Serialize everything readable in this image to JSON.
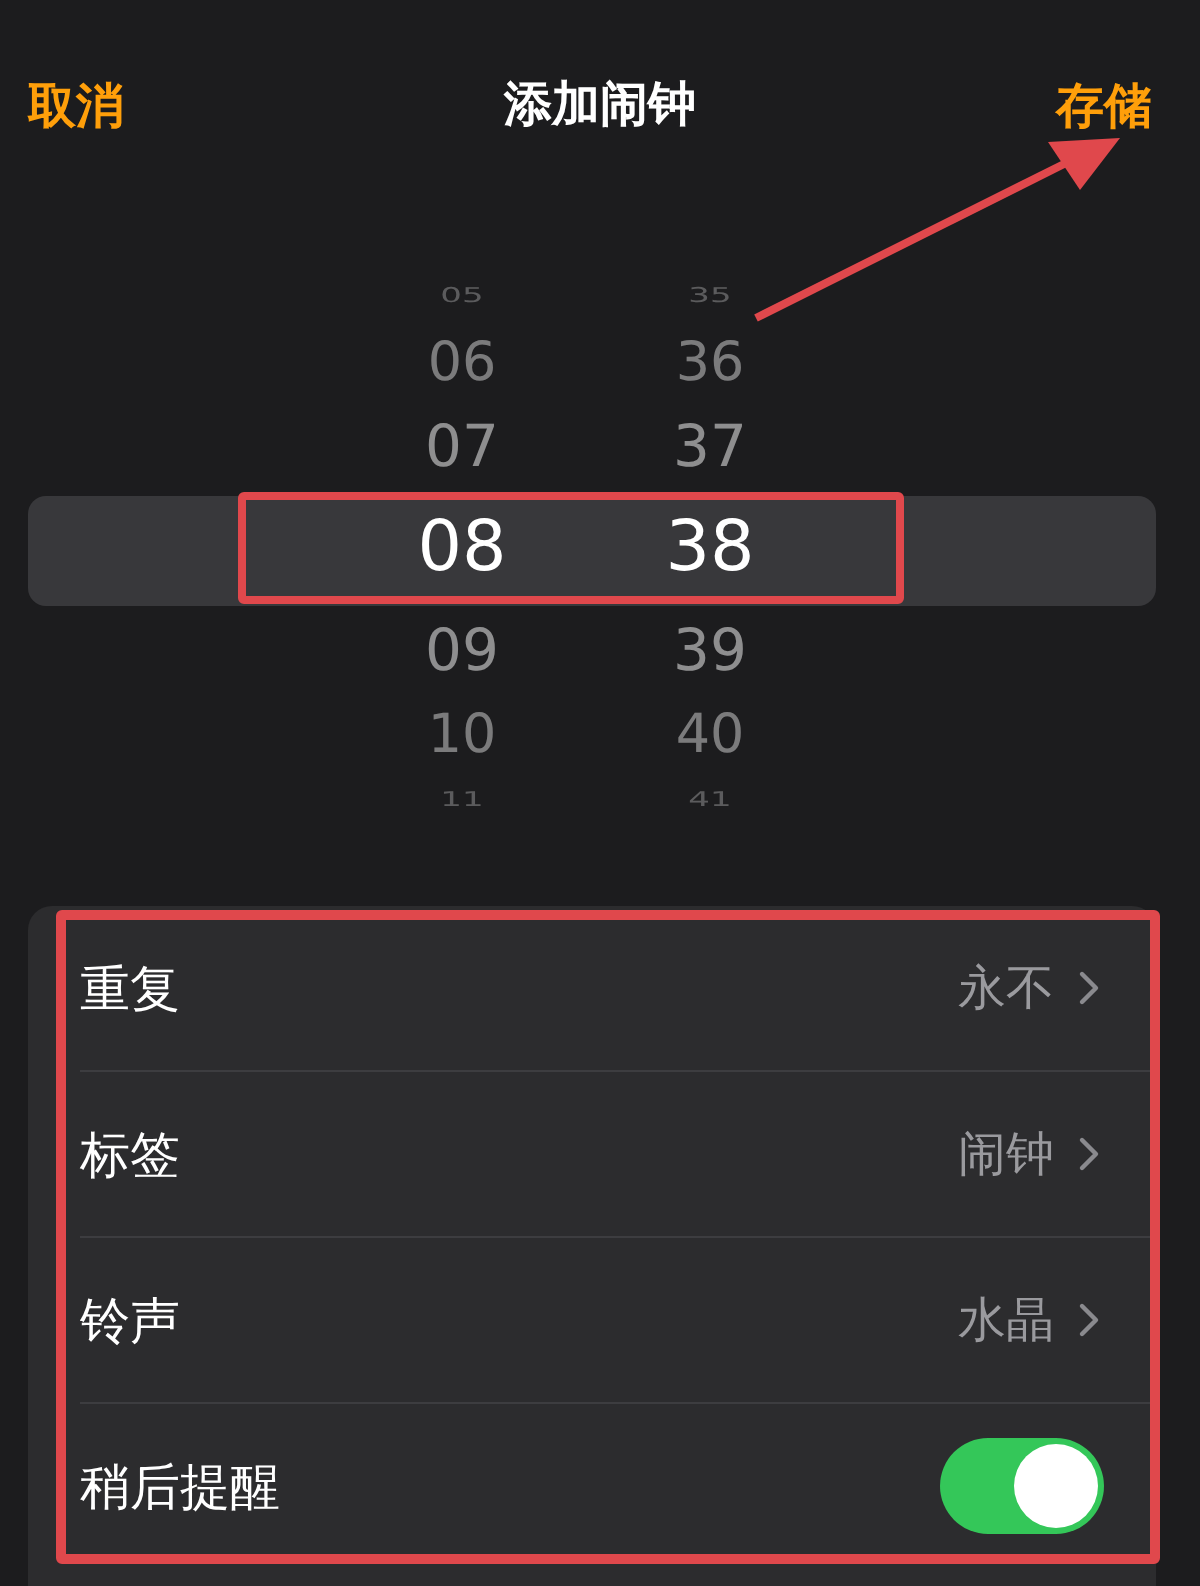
{
  "nav": {
    "cancel": "取消",
    "title": "添加闹钟",
    "save": "存储"
  },
  "picker": {
    "hours": [
      {
        "text": "05",
        "selected": false
      },
      {
        "text": "06",
        "selected": false
      },
      {
        "text": "07",
        "selected": false
      },
      {
        "text": "08",
        "selected": true
      },
      {
        "text": "09",
        "selected": false
      },
      {
        "text": "10",
        "selected": false
      },
      {
        "text": "11",
        "selected": false
      }
    ],
    "minutes": [
      {
        "text": "35",
        "selected": false
      },
      {
        "text": "36",
        "selected": false
      },
      {
        "text": "37",
        "selected": false
      },
      {
        "text": "38",
        "selected": true
      },
      {
        "text": "39",
        "selected": false
      },
      {
        "text": "40",
        "selected": false
      },
      {
        "text": "41",
        "selected": false
      }
    ]
  },
  "settings": [
    {
      "kind": "link",
      "label": "重复",
      "value": "永不"
    },
    {
      "kind": "link",
      "label": "标签",
      "value": "闹钟"
    },
    {
      "kind": "link",
      "label": "铃声",
      "value": "水晶"
    },
    {
      "kind": "toggle",
      "label": "稍后提醒",
      "on": true
    }
  ],
  "annotations": [
    {
      "kind": "box"
    },
    {
      "kind": "box"
    },
    {
      "kind": "arrow"
    }
  ]
}
